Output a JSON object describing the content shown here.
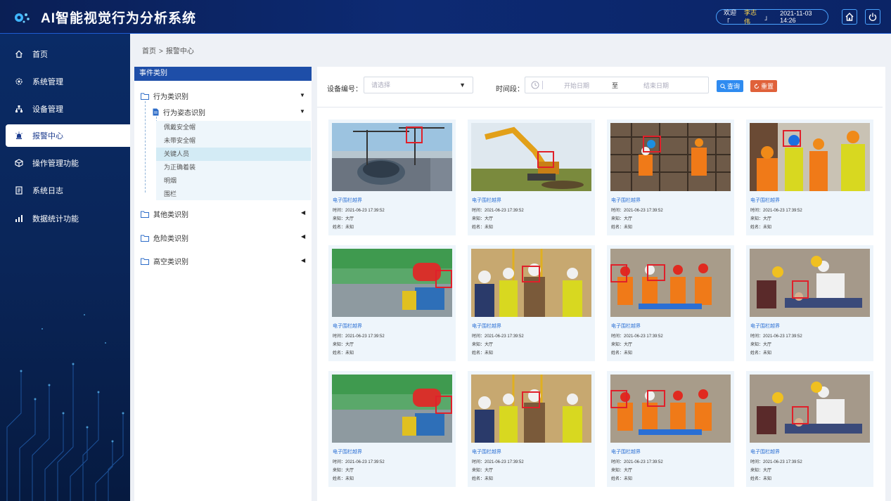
{
  "app": {
    "title": "AI智能视觉行为分析系统"
  },
  "header": {
    "welcome_prefix": "欢迎「",
    "user_name": "李志伟",
    "welcome_suffix": "」",
    "datetime": "2021-11-03  14:26",
    "home_icon": "home-icon",
    "power_icon": "power-icon"
  },
  "sidebar": {
    "items": [
      {
        "label": "首页",
        "icon": "home-icon"
      },
      {
        "label": "系统管理",
        "icon": "gear-icon"
      },
      {
        "label": "设备管理",
        "icon": "device-tree-icon"
      },
      {
        "label": "报警中心",
        "icon": "alarm-icon",
        "active": true
      },
      {
        "label": "操作管理功能",
        "icon": "cube-icon"
      },
      {
        "label": "系统日志",
        "icon": "document-icon"
      },
      {
        "label": "数据统计功能",
        "icon": "bar-chart-icon"
      }
    ]
  },
  "breadcrumb": {
    "home": "首页",
    "separator": ">",
    "current": "报警中心"
  },
  "tree": {
    "header": "事件类别",
    "groups": [
      {
        "label": "行为类识别",
        "expanded": true
      },
      {
        "label": "其他类识别",
        "expanded": false
      },
      {
        "label": "危险类识别",
        "expanded": false
      },
      {
        "label": "高空类识别",
        "expanded": false
      }
    ],
    "subgroup": "行为姿态识别",
    "leaves": [
      "佩戴安全帽",
      "未带安全帽",
      "关键人员",
      "为正确着装",
      "明烟",
      "围栏"
    ],
    "selected_leaf": "关键人员"
  },
  "filter": {
    "device_label": "设备编号：",
    "device_placeholder": "请选择",
    "period_label": "时间段：",
    "start_placeholder": "开始日期",
    "range_sep": "至",
    "end_placeholder": "结束日期",
    "query_label": "查询",
    "reset_label": "重置"
  },
  "colors": {
    "accent": "#1e4ea8",
    "query": "#2f8bf0",
    "reset": "#e0613a",
    "alarm_box": "#e0202a"
  },
  "cards": [
    {
      "title": "电子围栏越界",
      "time": "时间：2021-06-23  17:39:52",
      "source": "来知：大厅",
      "name": "姓名：未知",
      "scene": "construction-crane"
    },
    {
      "title": "电子围栏越界",
      "time": "时间：2021-06-23  17:39:52",
      "source": "来知：大厅",
      "name": "姓名：未知",
      "scene": "excavator"
    },
    {
      "title": "电子围栏越界",
      "time": "时间：2021-06-23  17:39:52",
      "source": "来知：大厅",
      "name": "姓名：未知",
      "scene": "rebar-workers"
    },
    {
      "title": "电子围栏越界",
      "time": "时间：2021-06-23  17:39:52",
      "source": "来知：大厅",
      "name": "姓名：未知",
      "scene": "helmet-workers"
    },
    {
      "title": "电子围栏越界",
      "time": "时间：2021-06-23  17:39:52",
      "source": "来知：大厅",
      "name": "姓名：未知",
      "scene": "mist-cannon"
    },
    {
      "title": "电子围栏越界",
      "time": "时间：2021-06-23  17:39:52",
      "source": "来知：大厅",
      "name": "姓名：未知",
      "scene": "site-inspection"
    },
    {
      "title": "电子围栏越界",
      "time": "时间：2021-06-23  17:39:52",
      "source": "来知：大厅",
      "name": "姓名：未知",
      "scene": "stretcher-drill"
    },
    {
      "title": "电子围栏越界",
      "time": "时间：2021-06-23  17:39:52",
      "source": "来知：大厅",
      "name": "姓名：未知",
      "scene": "first-aid"
    },
    {
      "title": "电子围栏越界",
      "time": "时间：2021-06-23  17:39:52",
      "source": "来知：大厅",
      "name": "姓名：未知",
      "scene": "mist-cannon"
    },
    {
      "title": "电子围栏越界",
      "time": "时间：2021-06-23  17:39:52",
      "source": "来知：大厅",
      "name": "姓名：未知",
      "scene": "site-inspection"
    },
    {
      "title": "电子围栏越界",
      "time": "时间：2021-06-23  17:39:52",
      "source": "来知：大厅",
      "name": "姓名：未知",
      "scene": "stretcher-drill"
    },
    {
      "title": "电子围栏越界",
      "time": "时间：2021-06-23  17:39:52",
      "source": "来知：大厅",
      "name": "姓名：未知",
      "scene": "first-aid"
    }
  ]
}
